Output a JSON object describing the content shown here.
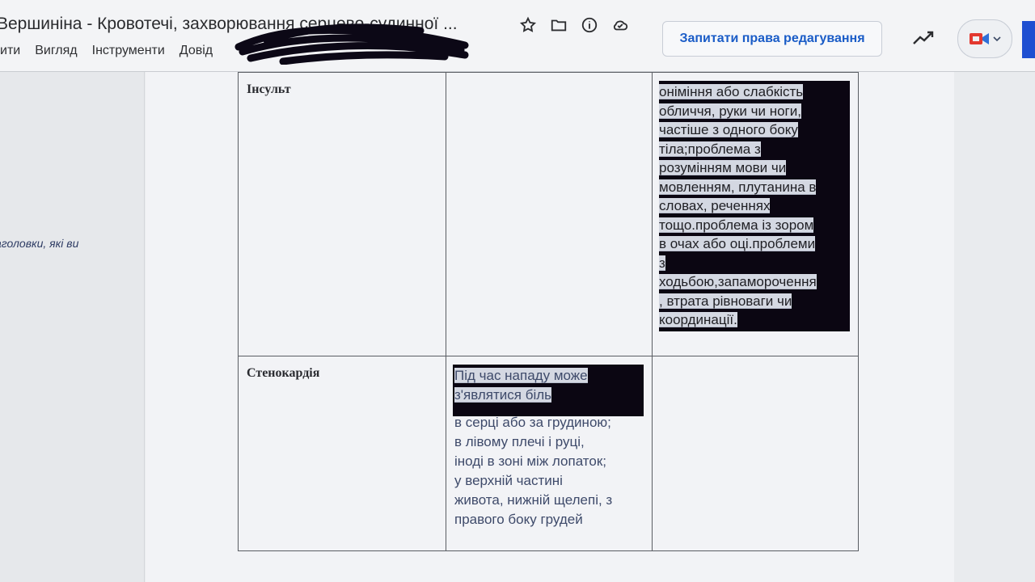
{
  "header": {
    "doc_title": "Вершиніна - Кровотечі, захворювання серцево-судинної ...",
    "edit_request_label": "Запитати права редагування"
  },
  "menu": {
    "items": [
      "ити",
      "Вигляд",
      "Інструменти",
      "Довід"
    ]
  },
  "outline": {
    "hint": "аголовки, які ви"
  },
  "icons": {
    "star": "star-icon",
    "folder": "folder-icon",
    "info": "info-icon",
    "cloud": "cloud-status-icon",
    "trend": "activity-trend-icon",
    "meet": "video-call-icon"
  },
  "table": {
    "rows": [
      {
        "name": "Інсульт",
        "col2": [],
        "col3": [
          "оніміння або слабкість",
          "обличчя, руки чи ноги,",
          "частіше з одного боку",
          "тіла;проблема з",
          "розумінням мови чи",
          "мовленням, плутанина в",
          "словах, реченнях",
          "тощо.проблема із зором",
          "в очах або оці.проблеми",
          "з",
          "ходьбою,запаморочення",
          ", втрата рівноваги чи",
          "координації."
        ]
      },
      {
        "name": "Стенокардія",
        "col2_top": [
          "Під час нападу може",
          "з'являтися біль"
        ],
        "col2": [
          "в серці або за грудиною;",
          "в лівому плечі і руці,",
          "іноді в зоні між лопаток;",
          "у верхній частині",
          "живота, нижній щелепі, з",
          "правого боку грудей"
        ],
        "col3": []
      }
    ]
  },
  "colors": {
    "accent": "#1a5cc7",
    "redaction": "#0b0612"
  }
}
